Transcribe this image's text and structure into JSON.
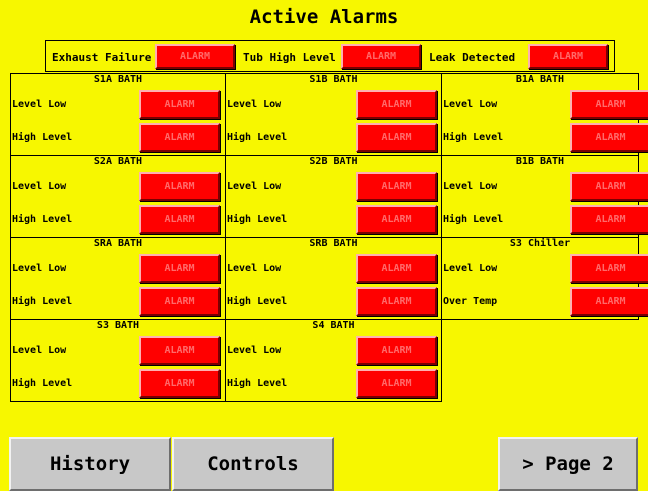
{
  "title": "Active Alarms",
  "colors": {
    "background": "#f7f700",
    "alarm": "#ff0000",
    "alarm_text": "#ff6a6a",
    "button": "#c8c8c8"
  },
  "top_alarms": [
    {
      "label": "Exhaust Failure",
      "status": "ALARM"
    },
    {
      "label": "Tub High Level",
      "status": "ALARM"
    },
    {
      "label": "Leak Detected",
      "status": "ALARM"
    }
  ],
  "panels": [
    {
      "title": "S1A BATH",
      "rows": [
        {
          "label": "Level Low",
          "status": "ALARM"
        },
        {
          "label": "High Level",
          "status": "ALARM"
        }
      ]
    },
    {
      "title": "S1B BATH",
      "rows": [
        {
          "label": "Level Low",
          "status": "ALARM"
        },
        {
          "label": "High Level",
          "status": "ALARM"
        }
      ]
    },
    {
      "title": "B1A BATH",
      "rows": [
        {
          "label": "Level Low",
          "status": "ALARM"
        },
        {
          "label": "High Level",
          "status": "ALARM"
        }
      ]
    },
    {
      "title": "S2A BATH",
      "rows": [
        {
          "label": "Level Low",
          "status": "ALARM"
        },
        {
          "label": "High Level",
          "status": "ALARM"
        }
      ]
    },
    {
      "title": "S2B BATH",
      "rows": [
        {
          "label": "Level Low",
          "status": "ALARM"
        },
        {
          "label": "High Level",
          "status": "ALARM"
        }
      ]
    },
    {
      "title": "B1B BATH",
      "rows": [
        {
          "label": "Level Low",
          "status": "ALARM"
        },
        {
          "label": "High Level",
          "status": "ALARM"
        }
      ]
    },
    {
      "title": "SRA BATH",
      "rows": [
        {
          "label": "Level Low",
          "status": "ALARM"
        },
        {
          "label": "High Level",
          "status": "ALARM"
        }
      ]
    },
    {
      "title": "SRB BATH",
      "rows": [
        {
          "label": "Level Low",
          "status": "ALARM"
        },
        {
          "label": "High Level",
          "status": "ALARM"
        }
      ]
    },
    {
      "title": "S3 Chiller",
      "rows": [
        {
          "label": "Level Low",
          "status": "ALARM"
        },
        {
          "label": "Over Temp",
          "status": "ALARM"
        }
      ]
    },
    {
      "title": "S3 BATH",
      "rows": [
        {
          "label": "Level Low",
          "status": "ALARM"
        },
        {
          "label": "High Level",
          "status": "ALARM"
        }
      ]
    },
    {
      "title": "S4 BATH",
      "rows": [
        {
          "label": "Level Low",
          "status": "ALARM"
        },
        {
          "label": "High Level",
          "status": "ALARM"
        }
      ]
    }
  ],
  "nav": {
    "history": "History",
    "controls": "Controls",
    "next_page": "> Page 2"
  }
}
